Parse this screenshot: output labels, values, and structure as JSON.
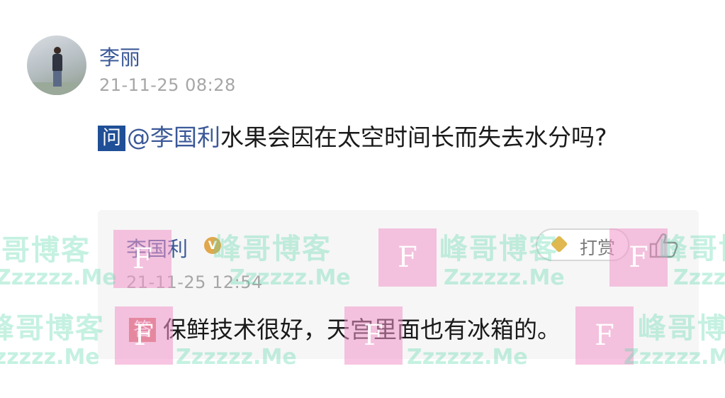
{
  "question": {
    "avatar_icon": "user-photo-avatar",
    "user": "李丽",
    "time": "21-11-25 08:28",
    "badge": "问",
    "mention": "@李国利",
    "text": "水果会因在太空时间长而失去水分吗?"
  },
  "answer": {
    "user": "李国利",
    "verified_badge": "V",
    "time": "21-11-25 12:54",
    "tip_label": "打赏",
    "tip_icon": "diamond-icon",
    "like_icon": "thumbs-up-icon",
    "badge": "答",
    "text": "保鲜技术很好，天宫里面也有冰箱的。"
  },
  "watermark": {
    "cn": "峰哥博客",
    "en": "Zzzzzz.Me",
    "letter": "F"
  },
  "colors": {
    "link_blue": "#3b5998",
    "question_badge": "#1f4f96",
    "answer_badge": "#d8796e",
    "timestamp_gray": "#a6a6a6",
    "card_bg": "#f6f6f6"
  }
}
